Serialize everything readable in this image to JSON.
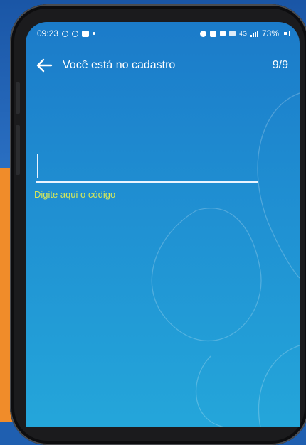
{
  "status_bar": {
    "time": "09:23",
    "battery": "73%",
    "network": "4G"
  },
  "header": {
    "title": "Você está no cadastro",
    "step": "9/9"
  },
  "code_input": {
    "value": "",
    "helper": "Digite aqui o código"
  },
  "colors": {
    "screen_top": "#1b7bc9",
    "screen_bottom": "#24a6da",
    "helper_text": "#d7e85a",
    "side_accent": "#f08c2a"
  }
}
